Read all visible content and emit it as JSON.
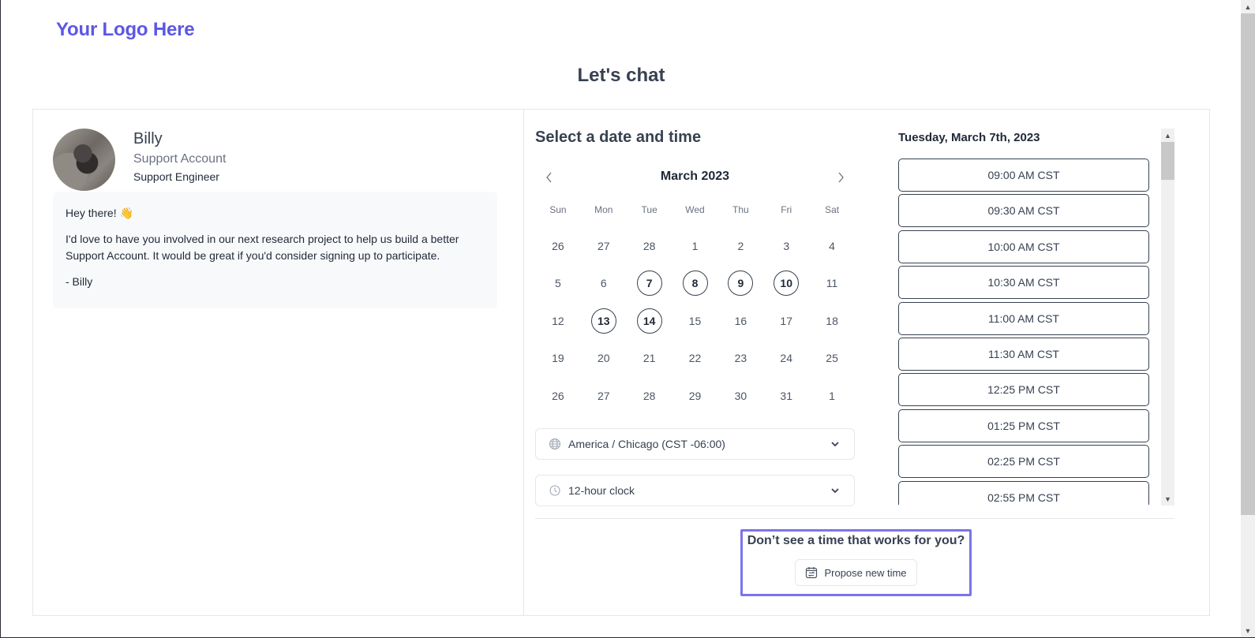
{
  "header": {
    "logo": "Your Logo Here",
    "title": "Let's chat"
  },
  "profile": {
    "name": "Billy",
    "company": "Support Account",
    "role": "Support Engineer",
    "avatar_icon": "dog-photo-avatar"
  },
  "message": {
    "greeting": "Hey there!",
    "greeting_emoji": "👋",
    "body": "I'd love to have you involved in our next research project to help us build a better Support Account. It would be great if you'd consider signing up to participate.",
    "signature": "- Billy"
  },
  "scheduler": {
    "title": "Select a date and time",
    "calendar": {
      "month_label": "March 2023",
      "prev_icon": "chevron-left-icon",
      "next_icon": "chevron-right-icon",
      "weekdays": [
        "Sun",
        "Mon",
        "Tue",
        "Wed",
        "Thu",
        "Fri",
        "Sat"
      ],
      "weeks": [
        [
          {
            "d": "26",
            "a": false
          },
          {
            "d": "27",
            "a": false
          },
          {
            "d": "28",
            "a": false
          },
          {
            "d": "1",
            "a": false
          },
          {
            "d": "2",
            "a": false
          },
          {
            "d": "3",
            "a": false
          },
          {
            "d": "4",
            "a": false
          }
        ],
        [
          {
            "d": "5",
            "a": false
          },
          {
            "d": "6",
            "a": false
          },
          {
            "d": "7",
            "a": true
          },
          {
            "d": "8",
            "a": true
          },
          {
            "d": "9",
            "a": true
          },
          {
            "d": "10",
            "a": true
          },
          {
            "d": "11",
            "a": false
          }
        ],
        [
          {
            "d": "12",
            "a": false
          },
          {
            "d": "13",
            "a": true
          },
          {
            "d": "14",
            "a": true
          },
          {
            "d": "15",
            "a": false
          },
          {
            "d": "16",
            "a": false
          },
          {
            "d": "17",
            "a": false
          },
          {
            "d": "18",
            "a": false
          }
        ],
        [
          {
            "d": "19",
            "a": false
          },
          {
            "d": "20",
            "a": false
          },
          {
            "d": "21",
            "a": false
          },
          {
            "d": "22",
            "a": false
          },
          {
            "d": "23",
            "a": false
          },
          {
            "d": "24",
            "a": false
          },
          {
            "d": "25",
            "a": false
          }
        ],
        [
          {
            "d": "26",
            "a": false
          },
          {
            "d": "27",
            "a": false
          },
          {
            "d": "28",
            "a": false
          },
          {
            "d": "29",
            "a": false
          },
          {
            "d": "30",
            "a": false
          },
          {
            "d": "31",
            "a": false
          },
          {
            "d": "1",
            "a": false
          }
        ]
      ]
    },
    "timezone": {
      "icon": "globe-icon",
      "value": "America / Chicago (CST -06:00)"
    },
    "clock_format": {
      "icon": "clock-icon",
      "value": "12-hour clock"
    },
    "selected_date": "Tuesday, March 7th, 2023",
    "time_slots": [
      "09:00 AM CST",
      "09:30 AM CST",
      "10:00 AM CST",
      "10:30 AM CST",
      "11:00 AM CST",
      "11:30 AM CST",
      "12:25 PM CST",
      "01:25 PM CST",
      "02:25 PM CST",
      "02:55 PM CST"
    ],
    "propose": {
      "title": "Don’t see a time that works for you?",
      "button_label": "Propose new time",
      "button_icon": "calendar-swap-icon",
      "highlight_color": "#7b74ea"
    }
  },
  "colors": {
    "brand": "#5b57e6",
    "text": "#374151",
    "border": "#e5e7eb"
  }
}
